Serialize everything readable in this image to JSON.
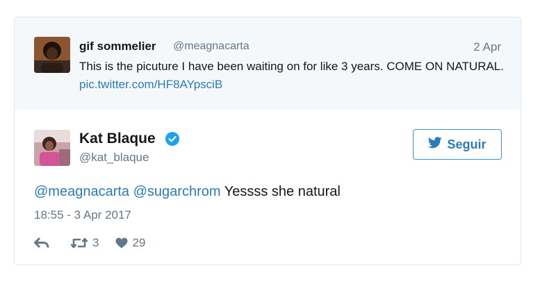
{
  "quoted_tweet": {
    "author_name": "gif sommelier",
    "author_handle": "@meagnacarta",
    "date": "2 Apr",
    "text": "This is the picuture I have been waiting on for like 3 years. COME ON NATURAL.",
    "link_text": "pic.twitter.com/HF8AYpsciB"
  },
  "main_tweet": {
    "author_name": "Kat Blaque",
    "author_handle": "@kat_blaque",
    "follow_label": "Seguir",
    "mention_1": "@meagnacarta",
    "mention_2": "@sugarchrom",
    "text": "Yessss she natural",
    "timestamp": "18:55 - 3 Apr 2017",
    "retweet_count": "3",
    "like_count": "29"
  },
  "colors": {
    "link_blue": "#2b7bb9",
    "muted_gray": "#657786",
    "parent_bg": "#f5f8fa",
    "verified_blue": "#1da1f2"
  },
  "icons": [
    "reply-icon",
    "retweet-icon",
    "heart-icon",
    "twitter-bird-icon",
    "verified-badge-icon"
  ]
}
